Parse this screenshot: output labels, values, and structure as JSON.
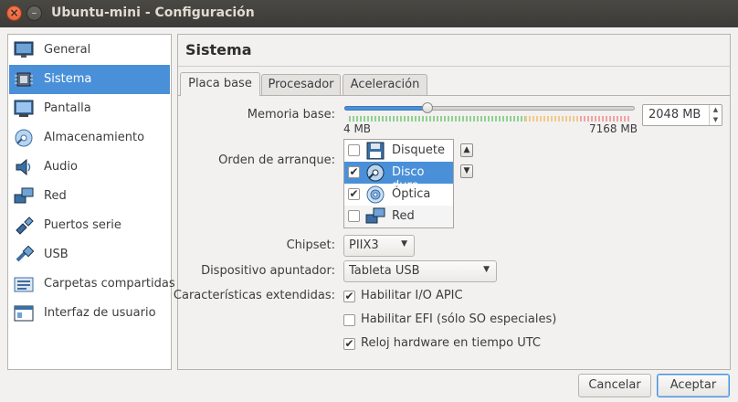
{
  "window": {
    "title": "Ubuntu-mini - Configuración",
    "close_glyph": "×",
    "minimize_glyph": "–"
  },
  "sidebar": {
    "items": [
      {
        "label": "General",
        "icon": "monitor-icon"
      },
      {
        "label": "Sistema",
        "icon": "chip-icon",
        "selected": true
      },
      {
        "label": "Pantalla",
        "icon": "display-icon"
      },
      {
        "label": "Almacenamiento",
        "icon": "disk-icon"
      },
      {
        "label": "Audio",
        "icon": "speaker-icon"
      },
      {
        "label": "Red",
        "icon": "network-icon"
      },
      {
        "label": "Puertos serie",
        "icon": "serial-port-icon"
      },
      {
        "label": "USB",
        "icon": "usb-icon"
      },
      {
        "label": "Carpetas compartidas",
        "icon": "folder-icon"
      },
      {
        "label": "Interfaz de usuario",
        "icon": "interface-icon"
      }
    ]
  },
  "main": {
    "title": "Sistema",
    "tabs": [
      {
        "label": "Placa base",
        "active": true
      },
      {
        "label": "Procesador"
      },
      {
        "label": "Aceleración"
      }
    ],
    "memory": {
      "label": "Memoria base:",
      "value": "2048 MB",
      "min_label": "4 MB",
      "max_label": "7168 MB",
      "min": 4,
      "max": 7168,
      "current": 2048
    },
    "boot_order": {
      "label": "Orden de arranque:",
      "items": [
        {
          "label": "Disquete",
          "checked": false,
          "icon": "floppy-icon"
        },
        {
          "label": "Disco duro",
          "checked": true,
          "icon": "hard-disk-icon",
          "selected": true
        },
        {
          "label": "Óptica",
          "checked": true,
          "icon": "optical-disc-icon"
        },
        {
          "label": "Red",
          "checked": false,
          "icon": "network-icon"
        }
      ],
      "move_up_glyph": "▲",
      "move_down_glyph": "▼"
    },
    "chipset": {
      "label": "Chipset:",
      "value": "PIIX3"
    },
    "pointing_device": {
      "label": "Dispositivo apuntador:",
      "value": "Tableta USB"
    },
    "extended_features": {
      "label": "Características extendidas:",
      "options": [
        {
          "label": "Habilitar I/O APIC",
          "checked": true
        },
        {
          "label": "Habilitar EFI (sólo SO especiales)",
          "checked": false
        },
        {
          "label": "Reloj hardware en tiempo UTC",
          "checked": true
        }
      ]
    }
  },
  "buttons": {
    "cancel": "Cancelar",
    "accept": "Aceptar"
  },
  "colors": {
    "accent": "#4a90d9",
    "titlebar": "#3c3b37",
    "close": "#e35b32"
  },
  "check_glyph": "✔",
  "dropdown_glyph": "▼"
}
